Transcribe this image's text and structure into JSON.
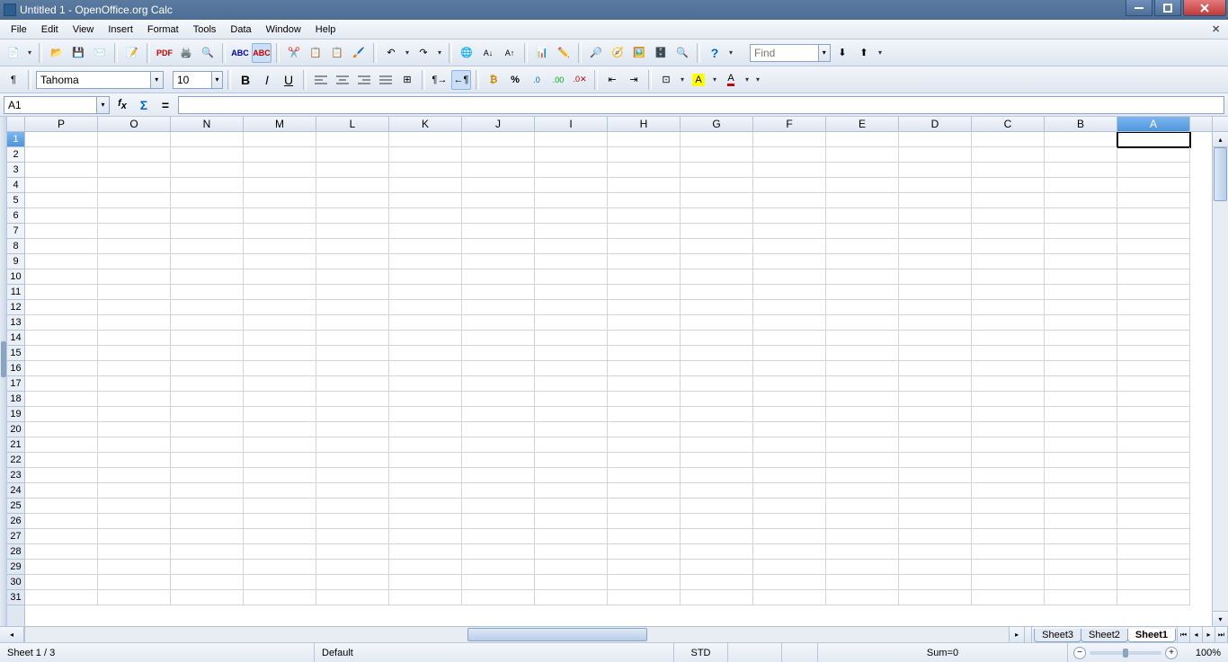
{
  "title": "Untitled 1 - OpenOffice.org Calc",
  "menus": [
    "File",
    "Edit",
    "View",
    "Insert",
    "Format",
    "Tools",
    "Data",
    "Window",
    "Help"
  ],
  "font_name": "Tahoma",
  "font_size": "10",
  "find_placeholder": "Find",
  "cell_ref": "A1",
  "formula_value": "",
  "columns": [
    "P",
    "O",
    "N",
    "M",
    "L",
    "K",
    "J",
    "I",
    "H",
    "G",
    "F",
    "E",
    "D",
    "C",
    "B",
    "A"
  ],
  "selected_column": "A",
  "row_count": 31,
  "selected_row": 1,
  "tabs": [
    "Sheet3",
    "Sheet2",
    "Sheet1"
  ],
  "active_tab": "Sheet1",
  "status": {
    "sheet": "Sheet 1 / 3",
    "style": "Default",
    "mode": "STD",
    "sum": "Sum=0",
    "zoom": "100%"
  },
  "icons": {
    "new": "new-doc-icon",
    "open": "folder-open-icon",
    "save": "save-icon",
    "mail": "mail-icon",
    "edit": "edit-file-icon",
    "pdf": "export-pdf-icon",
    "print": "print-icon",
    "preview": "page-preview-icon",
    "spell": "spellcheck-icon",
    "autospell": "auto-spellcheck-icon",
    "cut": "cut-icon",
    "copy": "copy-icon",
    "paste": "paste-icon",
    "painter": "format-paintbrush-icon",
    "undo": "undo-icon",
    "redo": "redo-icon",
    "link": "hyperlink-icon",
    "sortasc": "sort-asc-icon",
    "sortdesc": "sort-desc-icon",
    "chart": "chart-icon",
    "drawing": "show-draw-functions-icon",
    "findrep": "find-replace-icon",
    "navigator": "navigator-icon",
    "gallery": "gallery-icon",
    "datasrc": "data-sources-icon",
    "zoom": "zoom-icon",
    "help": "help-icon",
    "findnext": "find-next-icon",
    "findprev": "find-prev-icon",
    "styles": "styles-icon",
    "bold": "bold-icon",
    "italic": "italic-icon",
    "underline": "underline-icon",
    "alignl": "align-left-icon",
    "alignc": "align-center-icon",
    "alignr": "align-right-icon",
    "alignj": "align-justify-icon",
    "merge": "merge-cells-icon",
    "ltr": "text-ltr-icon",
    "rtl": "text-rtl-icon",
    "currency": "currency-icon",
    "percent": "percent-icon",
    "adddec": "add-decimal-icon",
    "deldec": "delete-decimal-icon",
    "stdfmt": "standard-format-icon",
    "decind": "decrease-indent-icon",
    "incind": "increase-indent-icon",
    "borders": "borders-icon",
    "bgcolor": "background-color-icon",
    "fontcolor": "font-color-icon",
    "fx": "function-wizard-icon",
    "sum_fn": "sum-icon",
    "eq": "function-icon"
  }
}
